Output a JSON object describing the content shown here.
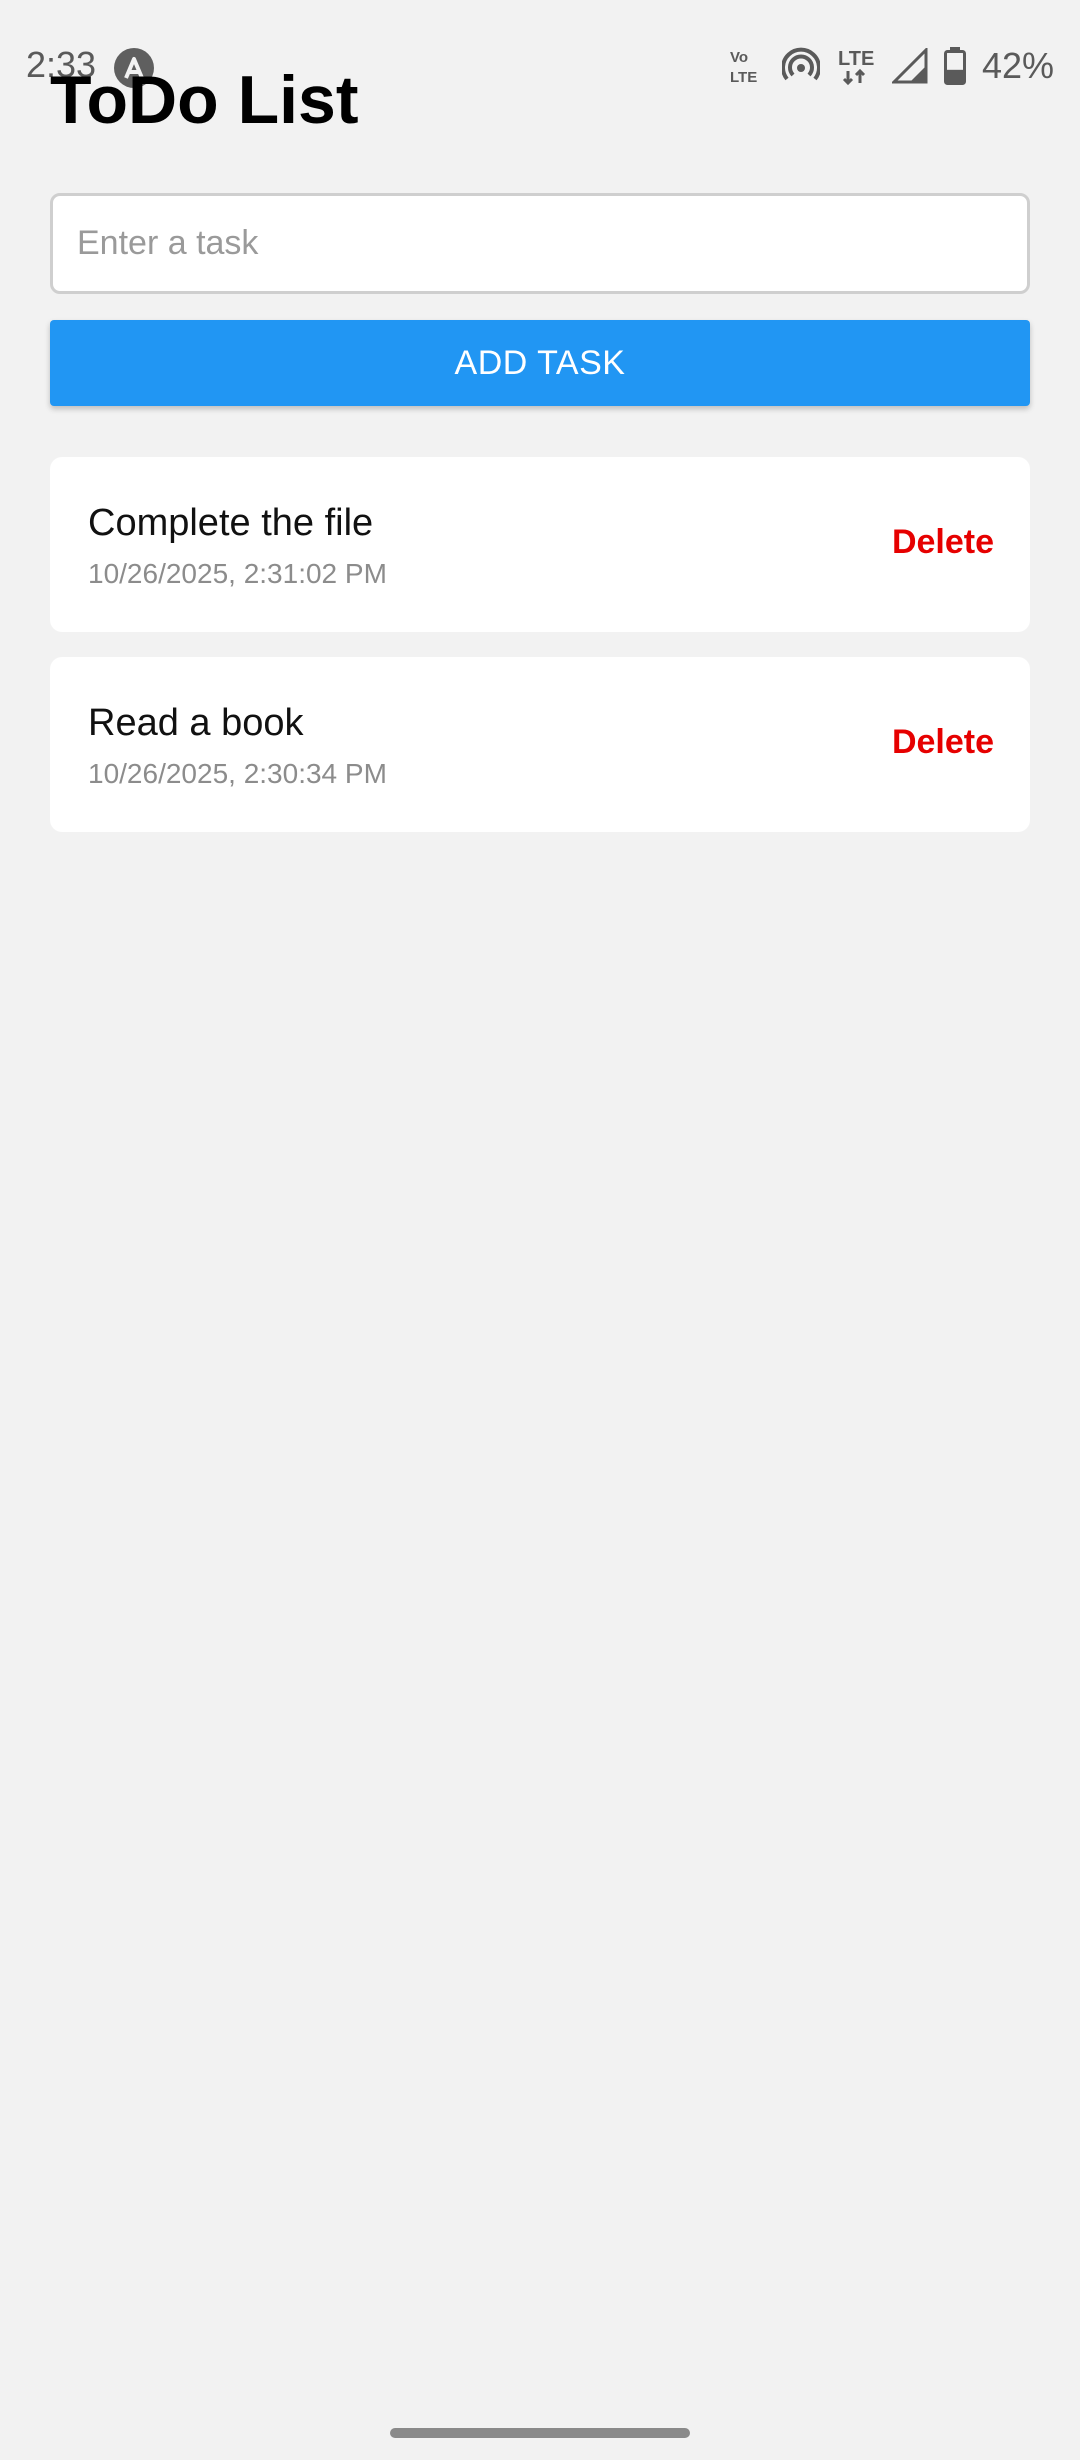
{
  "status_bar": {
    "time": "2:33",
    "app_icon": "a-circle-icon",
    "icons": [
      "volte-icon",
      "hotspot-icon",
      "lte-icon",
      "signal-icon",
      "battery-icon"
    ],
    "volte_label_top": "Vo",
    "volte_label_bottom": "LTE",
    "lte_label": "LTE",
    "battery_percent": "42%",
    "battery_level": 0.42
  },
  "app": {
    "title": "ToDo List"
  },
  "input": {
    "placeholder": "Enter a task",
    "value": ""
  },
  "add_button": {
    "label": "ADD TASK",
    "color": "#2196f3"
  },
  "tasks": [
    {
      "title": "Complete the file",
      "date": "10/26/2025, 2:31:02 PM",
      "delete_label": "Delete"
    },
    {
      "title": "Read a book",
      "date": "10/26/2025, 2:30:34 PM",
      "delete_label": "Delete"
    }
  ],
  "colors": {
    "background": "#f2f2f2",
    "delete": "#e60000",
    "accent": "#2196f3"
  }
}
